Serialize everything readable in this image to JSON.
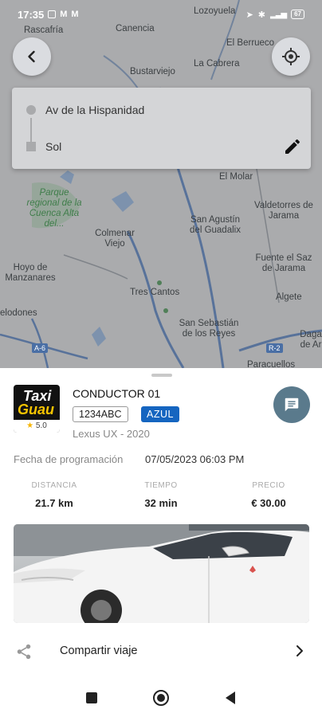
{
  "status_bar": {
    "time": "17:35",
    "battery": "67"
  },
  "map": {
    "places": [
      {
        "name": "Lozoyuela"
      },
      {
        "name": "Rascafría"
      },
      {
        "name": "Canencia"
      },
      {
        "name": "El Berrueco"
      },
      {
        "name": "Bustarviejo"
      },
      {
        "name": "La Cabrera"
      },
      {
        "name": "El Molar"
      },
      {
        "name": "Parque regional de la Cuenca Alta del..."
      },
      {
        "name": "Valdetorres de Jarama"
      },
      {
        "name": "San Agustín del Guadalix"
      },
      {
        "name": "Colmenar Viejo"
      },
      {
        "name": "Hoyo de Manzanares"
      },
      {
        "name": "Fuente el Saz de Jarama"
      },
      {
        "name": "Tres Cantos"
      },
      {
        "name": "Algete"
      },
      {
        "name": "elodones"
      },
      {
        "name": "San Sebastián de los Reyes"
      },
      {
        "name": "Daga de Ar"
      },
      {
        "name": "Paracuellos"
      }
    ],
    "shields": [
      "A-6",
      "R-2"
    ]
  },
  "route": {
    "origin": "Av de la Hispanidad",
    "destination": "Sol"
  },
  "trip": {
    "logo_line1": "Taxi",
    "logo_line2": "Guau",
    "rating": "5.0",
    "driver_name": "CONDUCTOR 01",
    "plate": "1234ABC",
    "color": "AZUL",
    "vehicle": "Lexus UX - 2020",
    "schedule_label": "Fecha de programación",
    "schedule_value": "07/05/2023 06:03 PM",
    "stats": {
      "distance_label": "DISTANCIA",
      "distance_value": "21.7 km",
      "time_label": "TIEMPO",
      "time_value": "32 min",
      "price_label": "PRECIO",
      "price_value": "€ 30.00"
    },
    "share_label": "Compartir viaje"
  },
  "colors": {
    "accent": "#1565c0",
    "chat": "#5a7a8c",
    "logo_yellow": "#f6c400"
  },
  "icons": [
    "back-arrow-icon",
    "my-location-icon",
    "edit-pencil-icon",
    "chat-icon",
    "share-icon",
    "chevron-right-icon",
    "star-icon",
    "recents-icon",
    "home-icon",
    "back-triangle-icon"
  ]
}
